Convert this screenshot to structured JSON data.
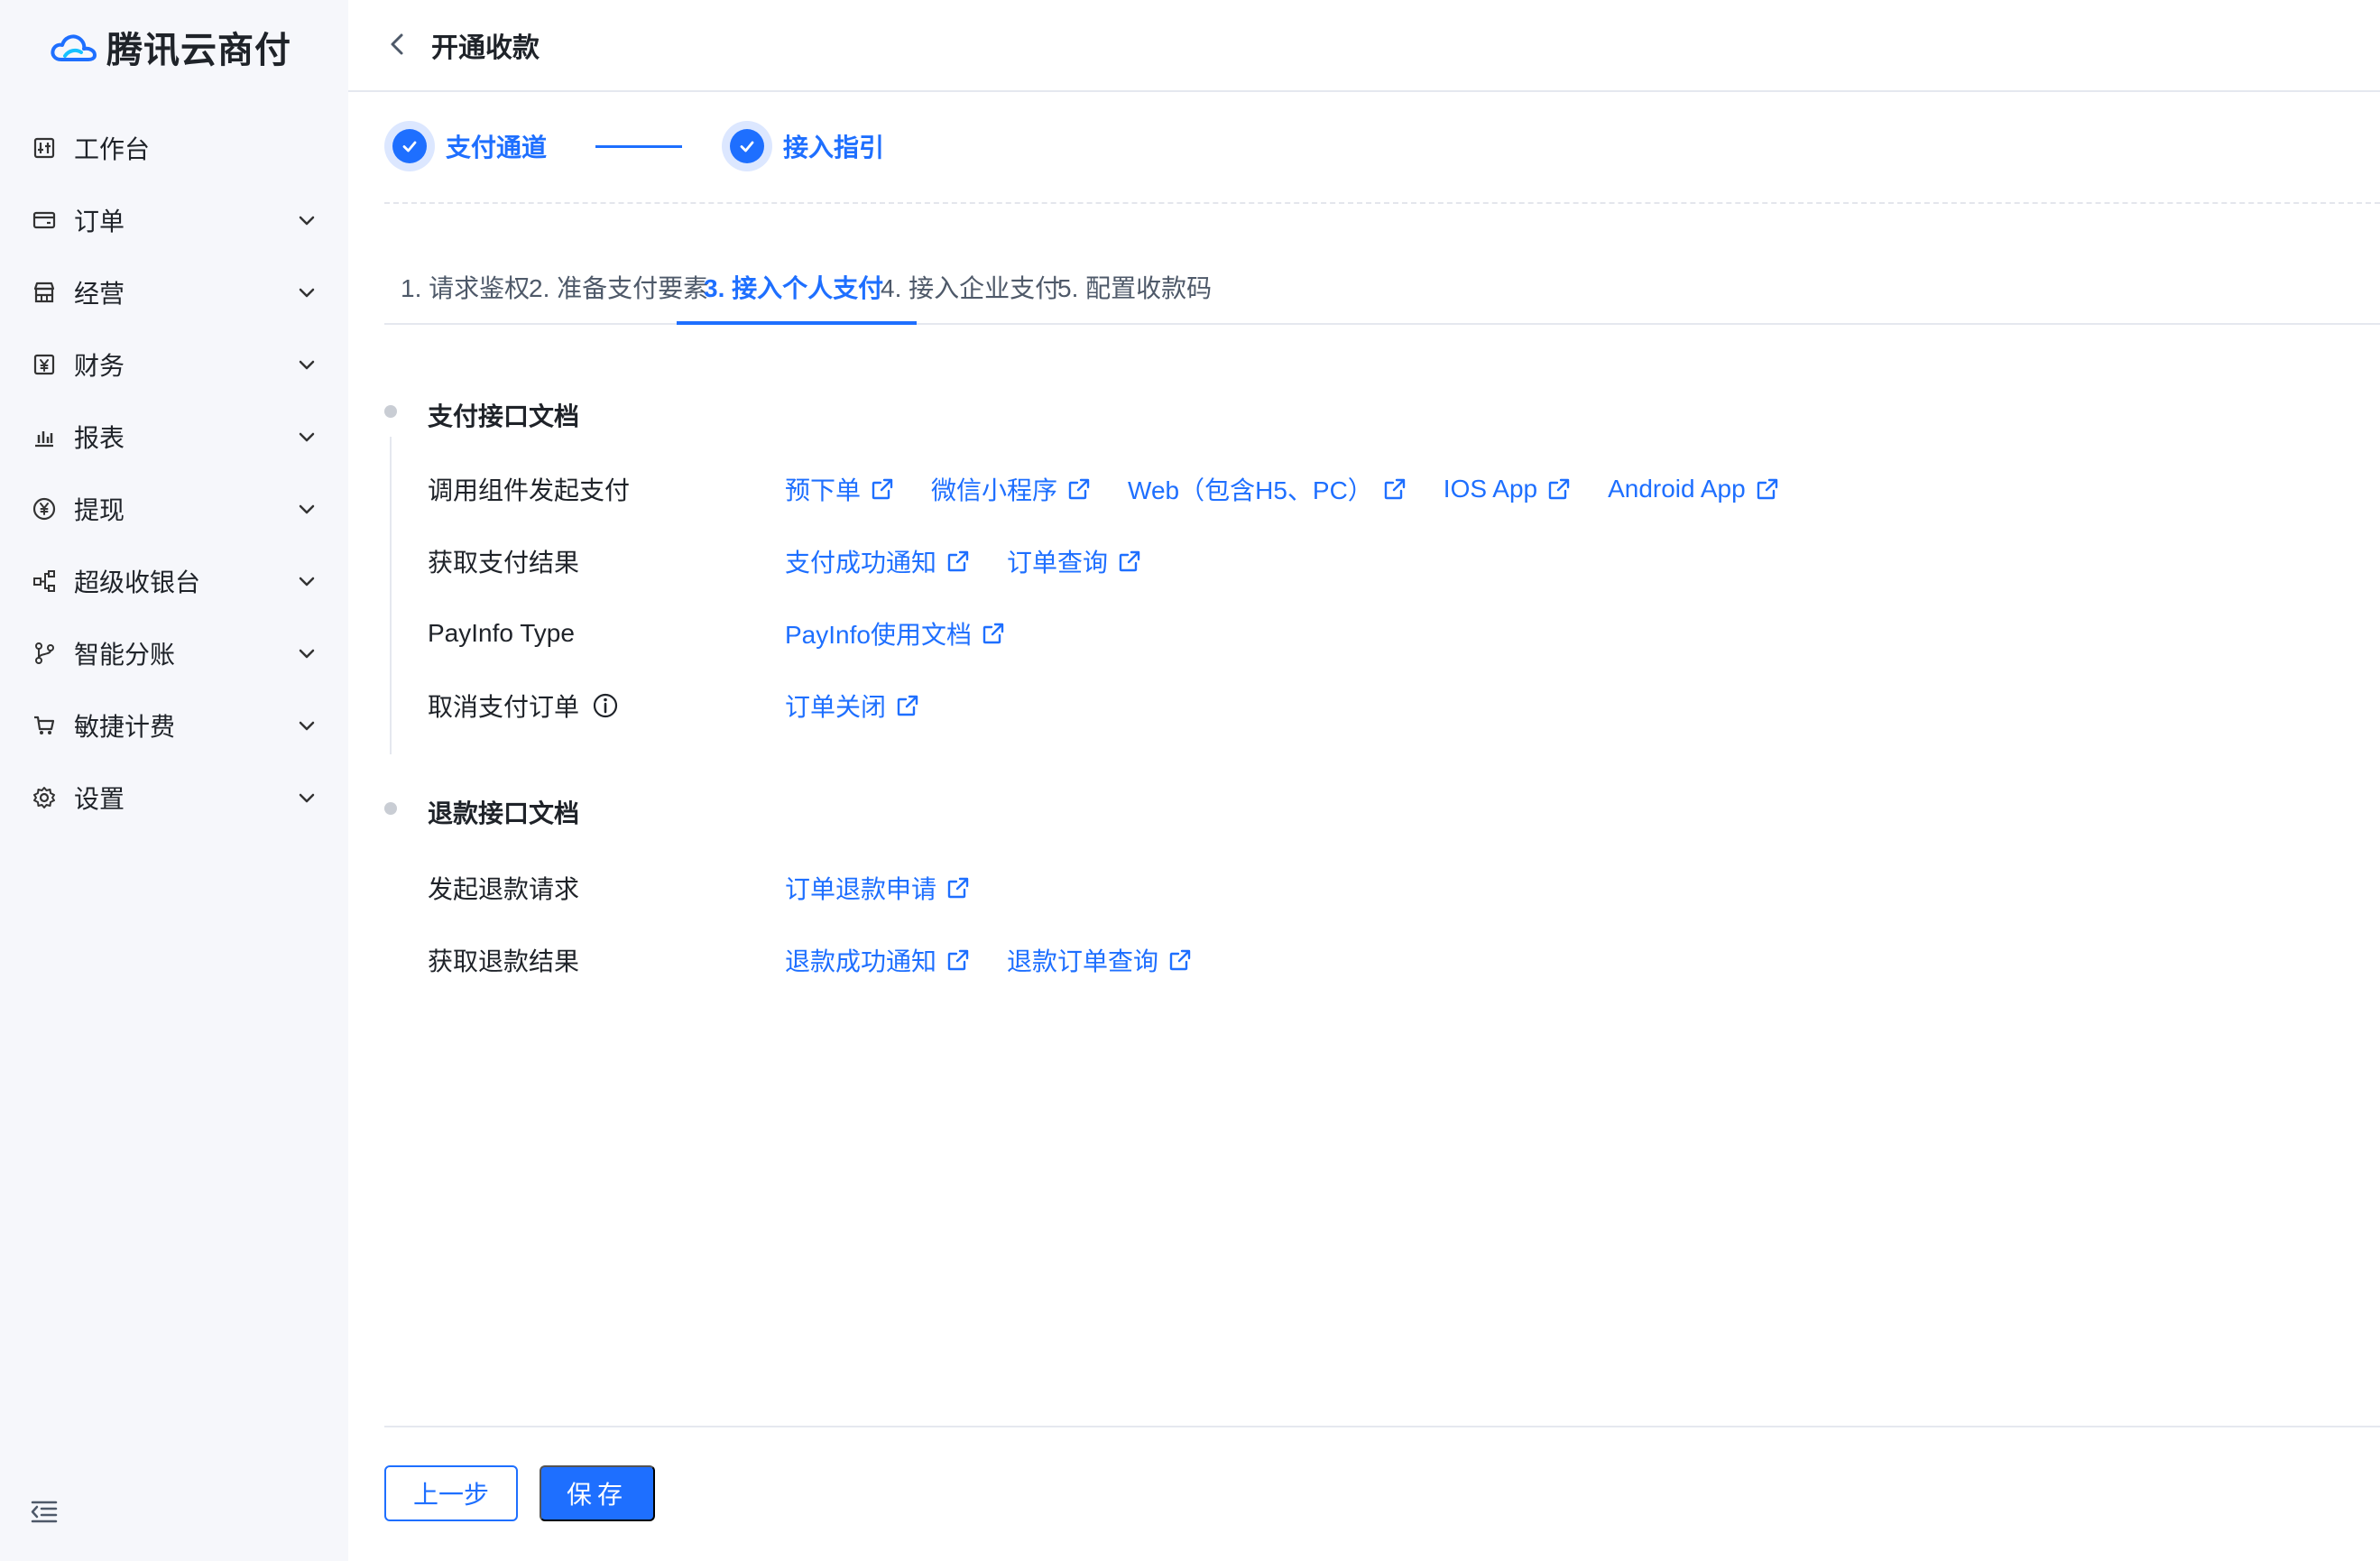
{
  "brand": {
    "name": "腾讯云商付"
  },
  "sidebar": {
    "items": [
      {
        "label": "工作台",
        "icon": "dashboard-icon",
        "expandable": false
      },
      {
        "label": "订单",
        "icon": "card-icon",
        "expandable": true
      },
      {
        "label": "经营",
        "icon": "store-icon",
        "expandable": true
      },
      {
        "label": "财务",
        "icon": "finance-icon",
        "expandable": true
      },
      {
        "label": "报表",
        "icon": "chart-icon",
        "expandable": true
      },
      {
        "label": "提现",
        "icon": "yuan-circle-icon",
        "expandable": true
      },
      {
        "label": "超级收银台",
        "icon": "network-icon",
        "expandable": true
      },
      {
        "label": "智能分账",
        "icon": "branch-icon",
        "expandable": true
      },
      {
        "label": "敏捷计费",
        "icon": "cart-icon",
        "expandable": true
      },
      {
        "label": "设置",
        "icon": "gear-icon",
        "expandable": true
      }
    ]
  },
  "header": {
    "title": "开通收款"
  },
  "steps": [
    {
      "label": "支付通道",
      "status": "done"
    },
    {
      "label": "接入指引",
      "status": "done"
    }
  ],
  "tabs": [
    {
      "label": "1. 请求鉴权",
      "active": false
    },
    {
      "label": "2. 准备支付要素",
      "active": false
    },
    {
      "label": "3. 接入个人支付",
      "active": true
    },
    {
      "label": "4. 接入企业支付",
      "active": false
    },
    {
      "label": "5. 配置收款码",
      "active": false
    }
  ],
  "sections": [
    {
      "title": "支付接口文档",
      "rows": [
        {
          "label": "调用组件发起支付",
          "links": [
            "预下单",
            "微信小程序",
            "Web（包含H5、PC）",
            "IOS App",
            "Android App"
          ]
        },
        {
          "label": "获取支付结果",
          "links": [
            "支付成功通知",
            "订单查询"
          ]
        },
        {
          "label": "PayInfo Type",
          "links": [
            "PayInfo使用文档"
          ]
        },
        {
          "label": "取消支付订单",
          "info": true,
          "links": [
            "订单关闭"
          ]
        }
      ]
    },
    {
      "title": "退款接口文档",
      "rows": [
        {
          "label": "发起退款请求",
          "links": [
            "订单退款申请"
          ]
        },
        {
          "label": "获取退款结果",
          "links": [
            "退款成功通知",
            "退款订单查询"
          ]
        }
      ]
    }
  ],
  "footer": {
    "prev_label": "上一步",
    "save_label": "保存"
  },
  "colors": {
    "accent": "#1e6fff",
    "sidebar_bg": "#f6f7fb",
    "text": "#1f2329"
  }
}
